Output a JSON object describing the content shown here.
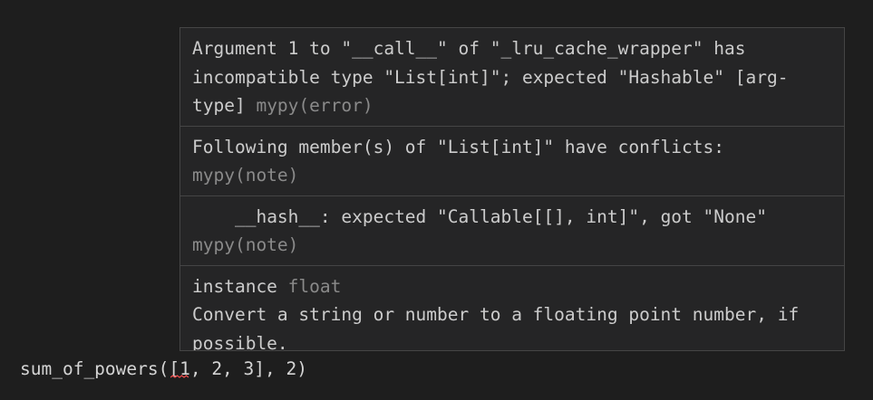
{
  "hover": {
    "diagnostics": [
      {
        "message": "Argument 1 to \"__call__\" of \"_lru_cache_wrapper\" has incompatible type \"List[int]\"; expected \"Hashable\" [arg-type]",
        "source": "mypy(error)"
      },
      {
        "message": "Following member(s) of \"List[int]\" have conflicts:",
        "source": "mypy(note)"
      },
      {
        "message": "    __hash__: expected \"Callable[[], int]\", got \"None\"",
        "source": "mypy(note)"
      }
    ],
    "signature": {
      "keyword": "instance",
      "type": "float",
      "doc": "Convert a string or number to a floating point number, if possible."
    }
  },
  "editor": {
    "code_line": "sum_of_powers([1, 2, 3], 2)"
  },
  "colors": {
    "background": "#1e1e1e",
    "hover_background": "#252526",
    "hover_border": "#454545",
    "text": "#cccccc",
    "muted": "#8a8a8a",
    "error_squiggle": "#f14c4c"
  }
}
